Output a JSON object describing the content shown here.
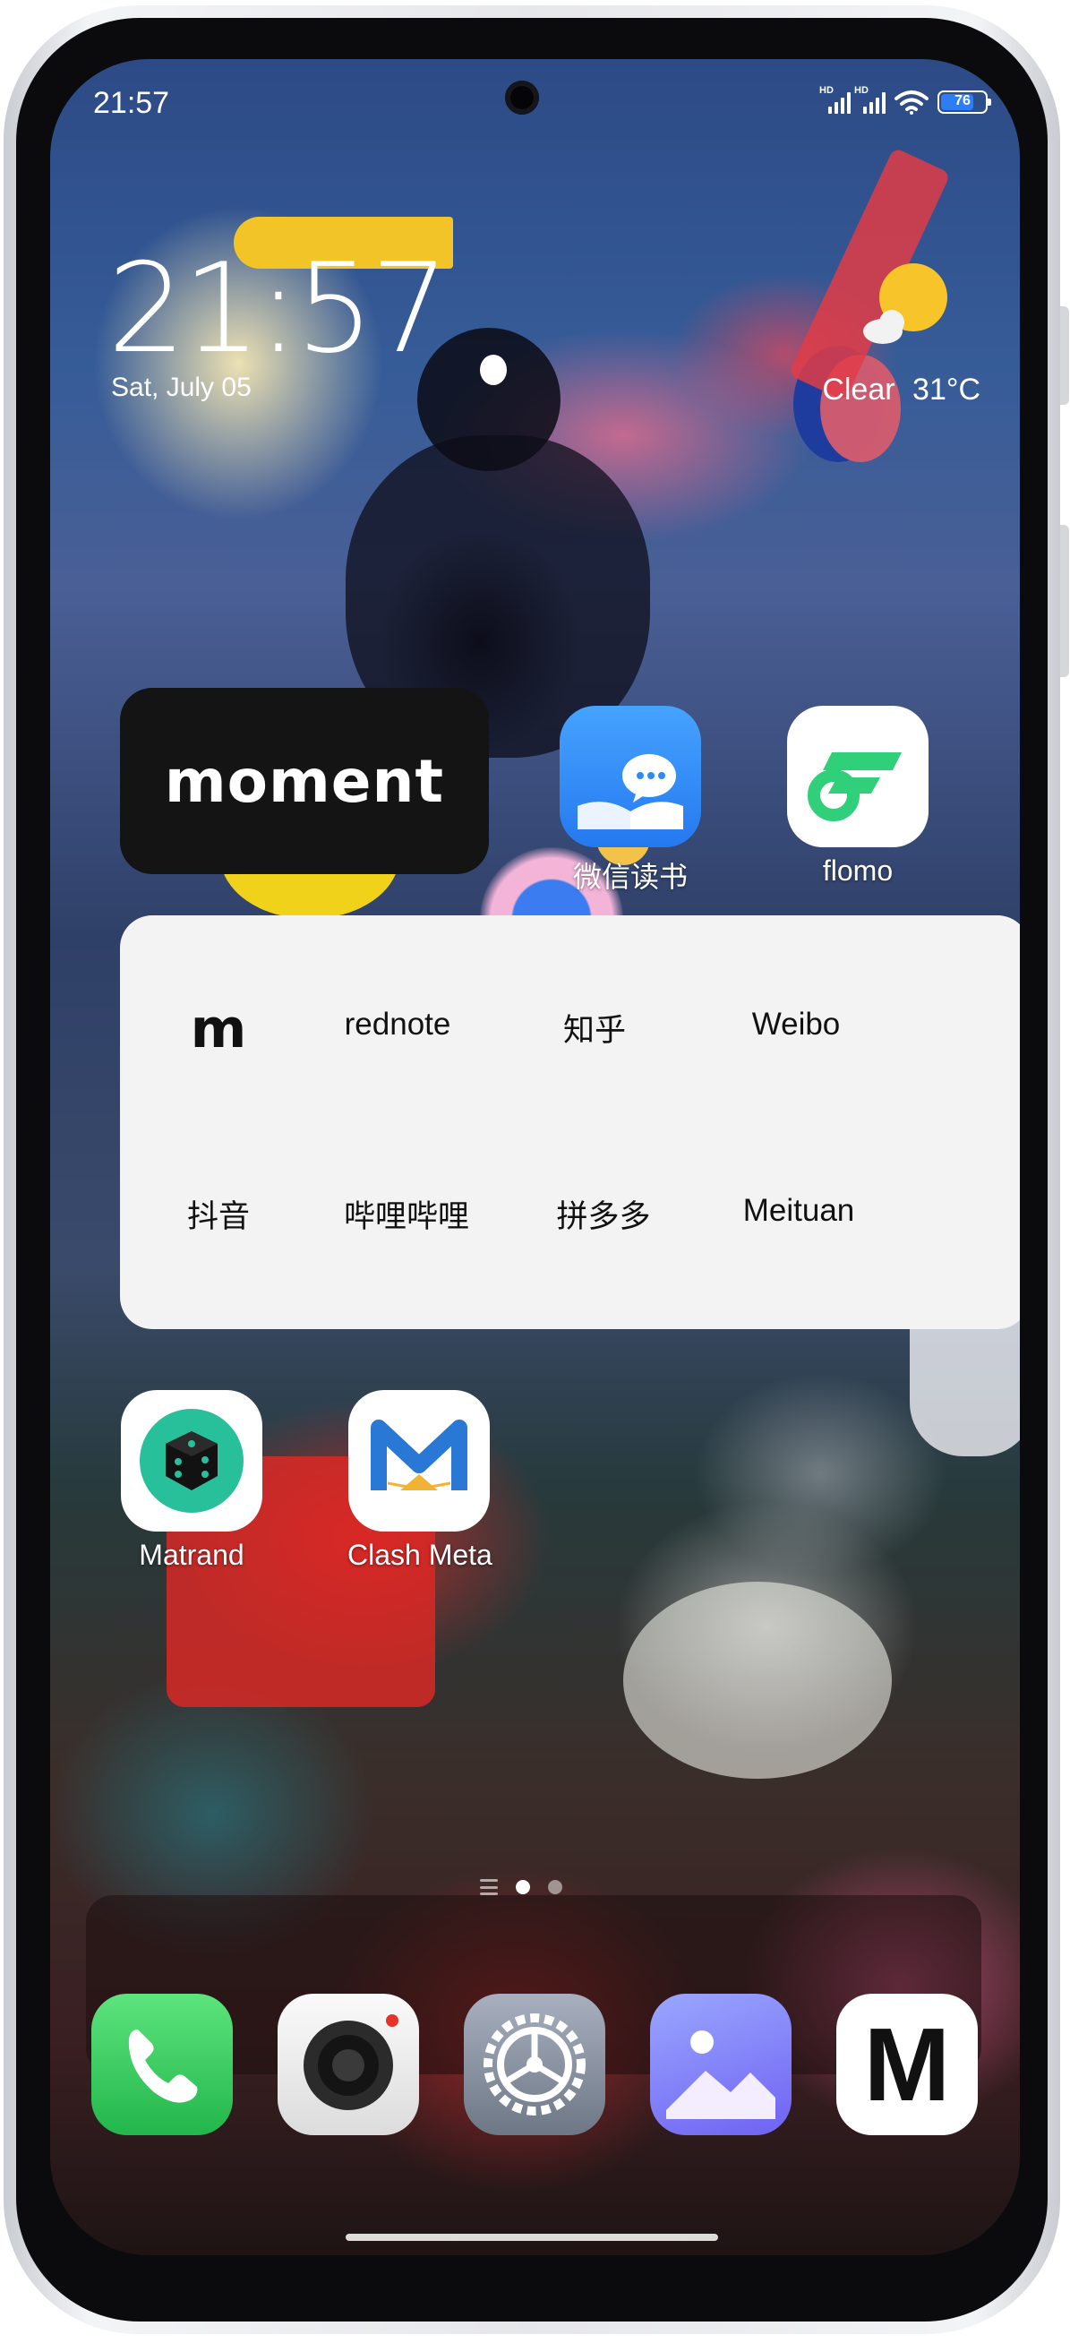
{
  "status_bar": {
    "time": "21:57",
    "signal_1_label": "HD",
    "signal_2_label": "HD",
    "battery_level": "76"
  },
  "clock_widget": {
    "time": "21:57",
    "date": "Sat, July 05"
  },
  "weather_widget": {
    "condition": "Clear",
    "temperature": "31°C",
    "icon": "sun-cloud-icon"
  },
  "moment_widget": {
    "label": "moment"
  },
  "apps_row_1": [
    {
      "label": "微信读书",
      "icon": "weread-icon"
    },
    {
      "label": "flomo",
      "icon": "flomo-icon"
    }
  ],
  "folder": {
    "items": [
      {
        "label": "m"
      },
      {
        "label": "rednote"
      },
      {
        "label": "知乎"
      },
      {
        "label": "Weibo"
      },
      {
        "label": "抖音"
      },
      {
        "label": "哔哩哔哩"
      },
      {
        "label": "拼多多"
      },
      {
        "label": "Meituan"
      }
    ]
  },
  "apps_row_2": [
    {
      "label": "Matrand",
      "icon": "dice-icon"
    },
    {
      "label": "Clash Meta",
      "icon": "clash-meta-cat-icon"
    }
  ],
  "dock": [
    {
      "icon": "phone-icon"
    },
    {
      "icon": "camera-icon"
    },
    {
      "icon": "settings-gear-icon"
    },
    {
      "icon": "gallery-icon"
    },
    {
      "icon": "m-app-icon",
      "glyph": "M"
    }
  ],
  "colors": {
    "battery_fill": "#2e7df6",
    "weread_blue": "#2f8af5",
    "flomo_green": "#30cf79",
    "matrand_teal": "#27c09a",
    "phone_green": "#34c759"
  }
}
